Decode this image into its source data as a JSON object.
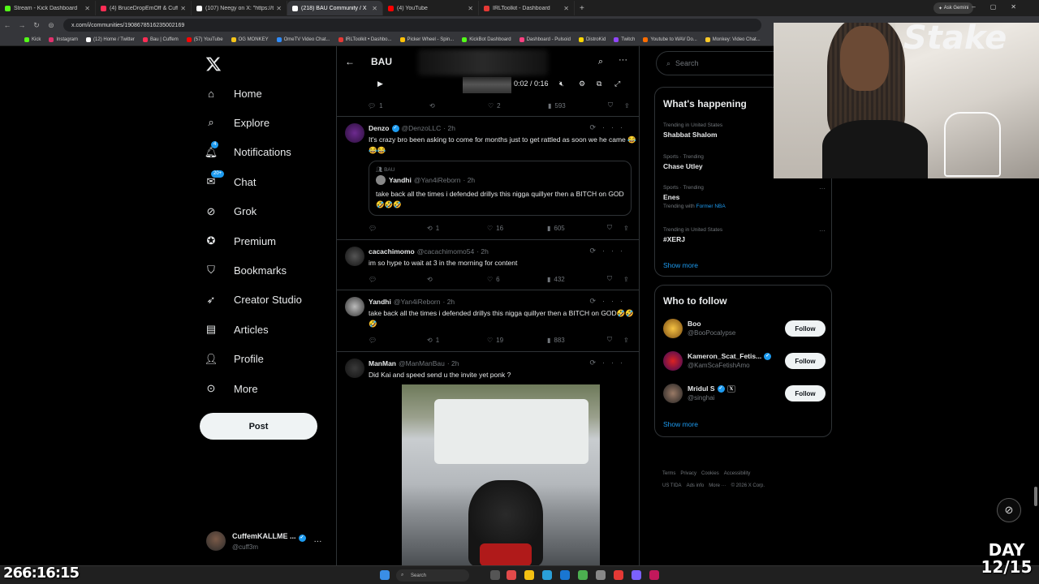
{
  "browser": {
    "tabs": [
      {
        "title": "Stream - Kick Dashboard",
        "color": "#53fc18"
      },
      {
        "title": "(4) BruceDropEmOff & Cuffem",
        "color": "#ff2d55"
      },
      {
        "title": "(107) Neegy on X: \"https://t.co",
        "color": "#ffffff"
      },
      {
        "title": "(218) BAU Community / X",
        "color": "#ffffff"
      },
      {
        "title": "(4) YouTube",
        "color": "#ff0000"
      },
      {
        "title": "IRLToolkit - Dashboard",
        "color": "#e53935"
      }
    ],
    "gemini_label": "Ask Gemini",
    "url": "x.com/i/communities/1908678516235002169",
    "bookmarks": [
      {
        "label": "Kick",
        "color": "#53fc18"
      },
      {
        "label": "Instagram",
        "color": "#e1306c"
      },
      {
        "label": "(12) Home / Twitter",
        "color": "#ffffff"
      },
      {
        "label": "Bau | Cuffem",
        "color": "#ff2d55"
      },
      {
        "label": "(57) YouTube",
        "color": "#ff0000"
      },
      {
        "label": "OG MONKEY",
        "color": "#f5c518"
      },
      {
        "label": "OmeTV Video Chat...",
        "color": "#2e8cff"
      },
      {
        "label": "IRLToolkit • Dashbo...",
        "color": "#e53935"
      },
      {
        "label": "Picker Wheel - Spin...",
        "color": "#ffc107"
      },
      {
        "label": "KickBot Dashboard",
        "color": "#53fc18"
      },
      {
        "label": "Dashboard - Pulsoid",
        "color": "#ff4081"
      },
      {
        "label": "DistroKid",
        "color": "#ffd600"
      },
      {
        "label": "Twitch",
        "color": "#9146ff"
      },
      {
        "label": "Youtube to WAV Do...",
        "color": "#ff6d00"
      },
      {
        "label": "Monkey: Video Chat...",
        "color": "#ffca28"
      }
    ]
  },
  "nav": {
    "items": [
      {
        "label": "Home",
        "icon": "home-icon"
      },
      {
        "label": "Explore",
        "icon": "search-icon"
      },
      {
        "label": "Notifications",
        "icon": "bell-icon",
        "badge": "4"
      },
      {
        "label": "Chat",
        "icon": "chat-icon",
        "badge": "20+"
      },
      {
        "label": "Grok",
        "icon": "grok-icon"
      },
      {
        "label": "Premium",
        "icon": "premium-icon"
      },
      {
        "label": "Bookmarks",
        "icon": "bookmark-icon"
      },
      {
        "label": "Creator Studio",
        "icon": "rocket-icon"
      },
      {
        "label": "Articles",
        "icon": "article-icon"
      },
      {
        "label": "Profile",
        "icon": "person-icon"
      },
      {
        "label": "More",
        "icon": "more-circle-icon"
      }
    ],
    "post_label": "Post",
    "account": {
      "name": "CuffemKALLME ...",
      "handle": "@cuff3m"
    }
  },
  "timeline": {
    "title": "BAU",
    "video_time": "0:02 / 0:16",
    "top_actions": {
      "replies": "1",
      "reposts": "",
      "likes": "2",
      "views": "593"
    },
    "tweets": [
      {
        "name": "Denzo",
        "handle": "@DenzoLLC",
        "time": "· 2h",
        "verified": true,
        "text": "It's crazy bro been asking to come for months just to get rattled as soon we he came 😂😂😂",
        "quote": {
          "community": "BAU",
          "name": "Yandhi",
          "handle": "@Yan4iReborn",
          "time": "· 2h",
          "text": "take back all the times i defended drillys this nigga quillyer then a BITCH on GOD🤣🤣🤣"
        },
        "actions": {
          "replies": "",
          "reposts": "1",
          "likes": "16",
          "views": "605"
        }
      },
      {
        "name": "cacachimomo",
        "handle": "@cacachimomo54",
        "time": "· 2h",
        "verified": false,
        "text": "im so hype to wait at 3 in the morning for content",
        "actions": {
          "replies": "",
          "reposts": "",
          "likes": "6",
          "views": "432"
        }
      },
      {
        "name": "Yandhi",
        "handle": "@Yan4iReborn",
        "time": "· 2h",
        "verified": false,
        "text": "take back all the times i defended drillys this nigga quillyer then a BITCH on GOD🤣🤣🤣",
        "actions": {
          "replies": "",
          "reposts": "1",
          "likes": "19",
          "views": "883"
        }
      },
      {
        "name": "ManMan",
        "handle": "@ManManBau",
        "time": "· 2h",
        "verified": false,
        "text": "Did Kai and speed send u the invite yet ponk ?"
      }
    ]
  },
  "sidebar": {
    "search_placeholder": "Search",
    "happening": {
      "title": "What's happening",
      "trends": [
        {
          "context": "Trending in United States",
          "topic": "Shabbat Shalom",
          "with": ""
        },
        {
          "context": "Sports · Trending",
          "topic": "Chase Utley",
          "with": ""
        },
        {
          "context": "Sports · Trending",
          "topic": "Enes",
          "with_prefix": "Trending with",
          "with": "Former NBA"
        },
        {
          "context": "Trending in United States",
          "topic": "#XERJ",
          "with": ""
        }
      ],
      "show_more": "Show more"
    },
    "who_to_follow": {
      "title": "Who to follow",
      "accounts": [
        {
          "name": "Boo",
          "handle": "@BooPocalypse",
          "button": "Follow"
        },
        {
          "name": "Kameron_Scat_Fetis...",
          "handle": "@KamScaFetishAmo",
          "button": "Follow"
        },
        {
          "name": "Mridul S",
          "handle": "@singhai",
          "button": "Follow"
        }
      ],
      "show_more": "Show more"
    },
    "footer": [
      "Terms",
      "Privacy",
      "Cookies",
      "Accessibility",
      "US TIDA",
      "Ads info",
      "More ···",
      "© 2026 X Corp."
    ]
  },
  "stream_overlay": {
    "timer": "266:16:15",
    "day_label": "DAY",
    "day_count": "12/15",
    "sponsor_text": "Stake"
  },
  "taskbar": {
    "search_label": "Search"
  }
}
